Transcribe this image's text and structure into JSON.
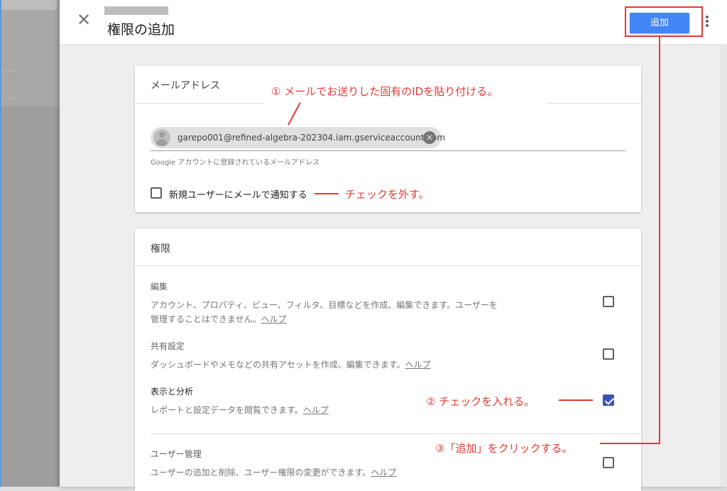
{
  "header": {
    "title": "権限の追加",
    "add_label": "追加"
  },
  "email_card": {
    "title": "メールアドレス",
    "chip_email": "garepo001@refined-algebra-202304.iam.gserviceaccount.com",
    "hint": "Google アカウントに登録されているメールアドレス",
    "notify_label": "新規ユーザーにメールで通知する",
    "notify_checked": false
  },
  "permissions_card": {
    "title": "権限",
    "items": [
      {
        "name": "編集",
        "desc_line1": "アカウント、プロパティ、ビュー、フィルタ、目標などを作成、編集できます。ユーザーを",
        "desc_line2": "管理することはできません。",
        "help": "ヘルプ",
        "checked": false
      },
      {
        "name": "共有設定",
        "desc_line1": "ダッシュボードやメモなどの共有アセットを作成、編集できます。",
        "help": "ヘルプ",
        "checked": false
      },
      {
        "name": "表示と分析",
        "desc_line1": "レポートと設定データを閲覧できます。",
        "help": "ヘルプ",
        "checked": true
      },
      {
        "name": "ユーザー管理",
        "desc_line1": "ユーザーの追加と削除、ユーザー権限の変更ができます。",
        "help": "ヘルプ",
        "checked": false
      }
    ]
  },
  "annotations": {
    "step1": "①  メールでお送りした固有のIDを貼り付ける。",
    "step_uncheck": "チェックを外す。",
    "step2": "② チェックを入れる。",
    "step3": "③「追加」をクリックする。"
  },
  "colors": {
    "accent": "#4285f4",
    "annotation": "#e53935",
    "checkbox_checked": "#3f51b5"
  },
  "icons": [
    "close-icon",
    "more-vert-icon",
    "person-icon",
    "remove-chip-icon",
    "check-icon"
  ]
}
